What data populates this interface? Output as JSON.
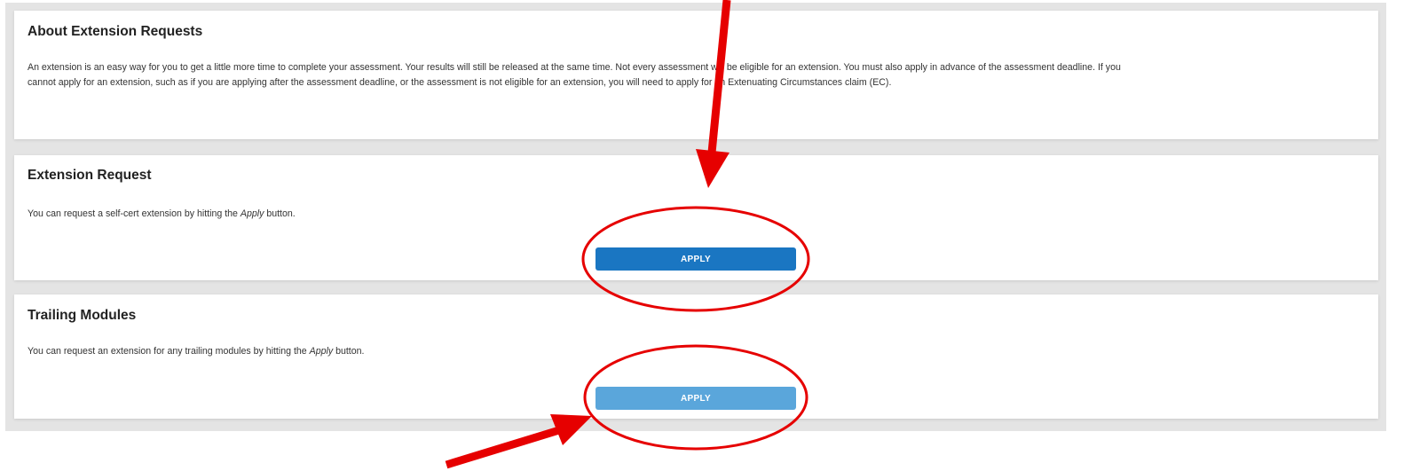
{
  "about": {
    "title": "About Extension Requests",
    "body_line1": "An extension is an easy way for you to get a little more time to complete your assessment. Your results will still be released at the same time. Not every assessment will be eligible for an extension. You must also apply in advance of the assessment deadline. If you",
    "body_line2": "cannot apply for an extension, such as if you are applying after the assessment deadline, or the assessment is not eligible for an extension, you will need to apply for an Extenuating Circumstances claim (EC)."
  },
  "extension_request": {
    "title": "Extension Request",
    "text_before": "You can request a self-cert extension by hitting the ",
    "text_emphasis": "Apply",
    "text_after": " button.",
    "button_label": "APPLY",
    "button_color": "#1a76c2"
  },
  "trailing_modules": {
    "title": "Trailing Modules",
    "text_before": "You can request an extension for any trailing modules by hitting the ",
    "text_emphasis": "Apply",
    "text_after": " button.",
    "button_label": "APPLY",
    "button_color": "#5aa6db"
  },
  "annotations": {
    "color": "#e60000"
  }
}
